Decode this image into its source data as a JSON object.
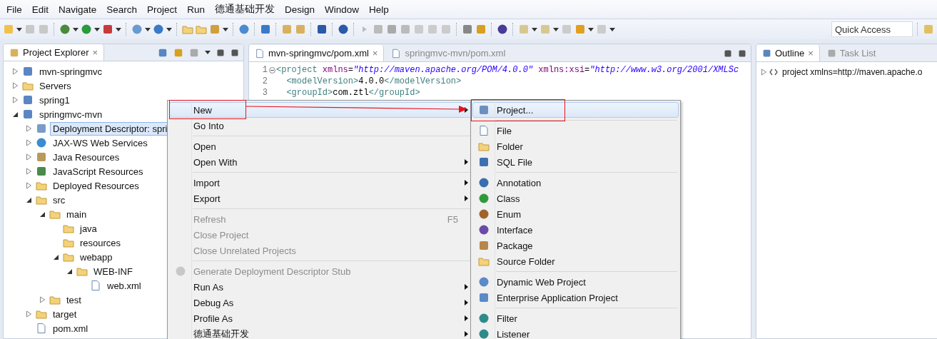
{
  "menu_bar": [
    "File",
    "Edit",
    "Navigate",
    "Search",
    "Project",
    "Run",
    "德通基础开发",
    "Design",
    "Window",
    "Help"
  ],
  "toolbar": {
    "quick_access": {
      "placeholder": "Quick Access"
    }
  },
  "project_explorer": {
    "title": "Project Explorer",
    "close": "×",
    "tree": [
      {
        "label": "mvn-springmvc",
        "kind": "project",
        "expanded": false,
        "selected": false
      },
      {
        "label": "Servers",
        "kind": "folder",
        "expanded": false,
        "selected": false
      },
      {
        "label": "spring1",
        "kind": "project",
        "expanded": false,
        "selected": false
      },
      {
        "label": "springmvc-mvn",
        "kind": "project",
        "expanded": true,
        "selected": false,
        "children": [
          {
            "label": "Deployment Descriptor: spri",
            "kind": "descriptor",
            "expanded": false,
            "selected": true
          },
          {
            "label": "JAX-WS Web Services",
            "kind": "webservice",
            "expanded": false,
            "selected": false
          },
          {
            "label": "Java Resources",
            "kind": "resources",
            "expanded": false,
            "selected": false
          },
          {
            "label": "JavaScript Resources",
            "kind": "library",
            "expanded": false,
            "selected": false
          },
          {
            "label": "Deployed Resources",
            "kind": "deployed",
            "expanded": false,
            "selected": false
          },
          {
            "label": "src",
            "kind": "folder",
            "expanded": true,
            "selected": false,
            "children": [
              {
                "label": "main",
                "kind": "folder",
                "expanded": true,
                "selected": false,
                "children": [
                  {
                    "label": "java",
                    "kind": "folder",
                    "selected": false
                  },
                  {
                    "label": "resources",
                    "kind": "folder",
                    "selected": false
                  },
                  {
                    "label": "webapp",
                    "kind": "folder",
                    "expanded": true,
                    "selected": false,
                    "children": [
                      {
                        "label": "WEB-INF",
                        "kind": "folder",
                        "expanded": true,
                        "selected": false,
                        "children": [
                          {
                            "label": "web.xml",
                            "kind": "xml",
                            "selected": false
                          }
                        ]
                      }
                    ]
                  }
                ]
              },
              {
                "label": "test",
                "kind": "folder",
                "expanded": false,
                "selected": false
              }
            ]
          },
          {
            "label": "target",
            "kind": "folder",
            "expanded": false,
            "selected": false
          },
          {
            "label": "pom.xml",
            "kind": "maven",
            "selected": false
          }
        ]
      }
    ]
  },
  "editor": {
    "tabs": [
      {
        "label": "mvn-springmvc/pom.xml",
        "selected": true,
        "close": "×"
      },
      {
        "label": "springmvc-mvn/pom.xml",
        "selected": false
      }
    ],
    "lines": [
      {
        "number": "1",
        "segments": [
          {
            "kind": "tag",
            "text": "<project "
          },
          {
            "kind": "attr",
            "text": "xmlns"
          },
          {
            "kind": "text",
            "text": "="
          },
          {
            "kind": "value",
            "text": "\"http://maven.apache.org/POM/4.0.0\" "
          },
          {
            "kind": "attr",
            "text": "xmlns:xsi"
          },
          {
            "kind": "text",
            "text": "="
          },
          {
            "kind": "value",
            "text": "\"http://www.w3.org/2001/XMLSc"
          }
        ]
      },
      {
        "number": "2",
        "segments": [
          {
            "kind": "tag",
            "text": "  <modelVersion>"
          },
          {
            "kind": "text",
            "text": "4.0.0"
          },
          {
            "kind": "tag",
            "text": "</modelVersion>"
          }
        ]
      },
      {
        "number": "3",
        "segments": [
          {
            "kind": "tag",
            "text": "  <groupId>"
          },
          {
            "kind": "text",
            "text": "com.ztl"
          },
          {
            "kind": "tag",
            "text": "</groupId>"
          }
        ]
      }
    ]
  },
  "outline": {
    "tabs": [
      {
        "label": "Outline",
        "selected": true,
        "close": "×"
      },
      {
        "label": "Task List",
        "selected": false
      }
    ],
    "tree": [
      {
        "label": "project xmlns=http://maven.apache.o",
        "expanded": false
      }
    ]
  },
  "context_menu": {
    "groups": [
      [
        {
          "label": "New",
          "disabled": false,
          "submenu": true,
          "selected": true
        },
        {
          "label": "Go Into",
          "disabled": false,
          "submenu": false,
          "selected": false
        }
      ],
      [
        {
          "label": "Open",
          "disabled": false,
          "submenu": false,
          "selected": false
        },
        {
          "label": "Open With",
          "disabled": false,
          "submenu": true,
          "selected": false
        }
      ],
      [
        {
          "label": "Import",
          "disabled": false,
          "submenu": true,
          "selected": false
        },
        {
          "label": "Export",
          "disabled": false,
          "submenu": true,
          "selected": false
        }
      ],
      [
        {
          "label": "Refresh",
          "disabled": true,
          "submenu": false,
          "selected": false,
          "shortcut": "F5"
        },
        {
          "label": "Close Project",
          "disabled": true,
          "submenu": false,
          "selected": false
        },
        {
          "label": "Close Unrelated Projects",
          "disabled": true,
          "submenu": false,
          "selected": false
        }
      ],
      [
        {
          "label": "Generate Deployment Descriptor Stub",
          "disabled": true,
          "submenu": false,
          "selected": false,
          "kind": "stub"
        },
        {
          "label": "Run As",
          "disabled": false,
          "submenu": true,
          "selected": false
        },
        {
          "label": "Debug As",
          "disabled": false,
          "submenu": true,
          "selected": false
        },
        {
          "label": "Profile As",
          "disabled": false,
          "submenu": true,
          "selected": false
        },
        {
          "label": "德通基础开发",
          "disabled": false,
          "submenu": true,
          "selected": false
        }
      ]
    ]
  },
  "new_submenu": {
    "groups": [
      [
        {
          "label": "Project...",
          "kind": "project",
          "selected": true
        }
      ],
      [
        {
          "label": "File",
          "kind": "file",
          "selected": false
        },
        {
          "label": "Folder",
          "kind": "folder",
          "selected": false
        },
        {
          "label": "SQL File",
          "kind": "sql",
          "selected": false
        }
      ],
      [
        {
          "label": "Annotation",
          "kind": "annotation",
          "selected": false
        },
        {
          "label": "Class",
          "kind": "class",
          "selected": false
        },
        {
          "label": "Enum",
          "kind": "enum",
          "selected": false
        },
        {
          "label": "Interface",
          "kind": "interface",
          "selected": false
        },
        {
          "label": "Package",
          "kind": "package",
          "selected": false
        },
        {
          "label": "Source Folder",
          "kind": "source",
          "selected": false
        }
      ],
      [
        {
          "label": "Dynamic Web Project",
          "kind": "webproject",
          "selected": false
        },
        {
          "label": "Enterprise Application Project",
          "kind": "earproject",
          "selected": false
        }
      ],
      [
        {
          "label": "Filter",
          "kind": "filter",
          "selected": false
        },
        {
          "label": "Listener",
          "kind": "listener",
          "selected": false
        }
      ]
    ]
  }
}
